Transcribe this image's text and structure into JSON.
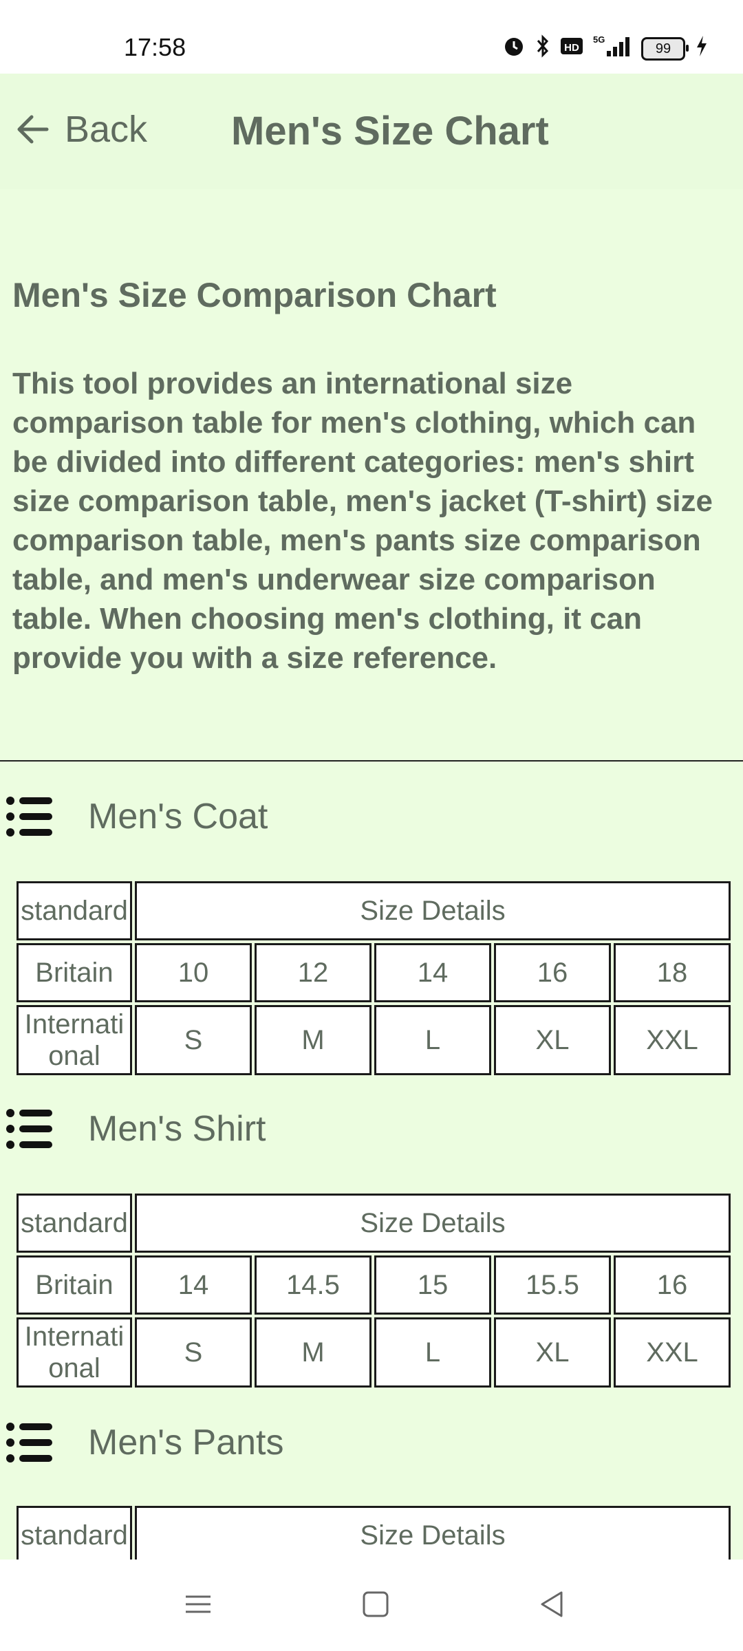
{
  "status_bar": {
    "time": "17:58",
    "battery": "99",
    "icons": [
      "alarm-icon",
      "bluetooth-icon",
      "hd-icon",
      "5g-signal-icon",
      "battery-icon",
      "charging-icon"
    ]
  },
  "header": {
    "back_label": "Back",
    "title": "Men's Size Chart"
  },
  "intro": {
    "title": "Men's Size Comparison Chart",
    "text": "This tool provides an international size comparison table for men's clothing, which can be divided into different categories: men's shirt size comparison table, men's jacket (T-shirt) size comparison table, men's pants size comparison table, and men's underwear size comparison table. When choosing men's clothing, it can provide you with a size reference."
  },
  "sections": [
    {
      "label": "Men's Coat",
      "header": [
        "standard",
        "Size Details"
      ],
      "rows": [
        [
          "Britain",
          "10",
          "12",
          "14",
          "16",
          "18"
        ],
        [
          "Internati onal",
          "S",
          "M",
          "L",
          "XL",
          "XXL"
        ]
      ]
    },
    {
      "label": "Men's Shirt",
      "header": [
        "standard",
        "Size Details"
      ],
      "rows": [
        [
          "Britain",
          "14",
          "14.5",
          "15",
          "15.5",
          "16"
        ],
        [
          "Internati onal",
          "S",
          "M",
          "L",
          "XL",
          "XXL"
        ]
      ]
    },
    {
      "label": "Men's Pants",
      "header": [
        "standard",
        "Size Details"
      ],
      "rows": []
    }
  ],
  "colors": {
    "header_bg": "#e9fbdd",
    "content_bg": "#ecfde0",
    "text": "#5f6b5f"
  }
}
